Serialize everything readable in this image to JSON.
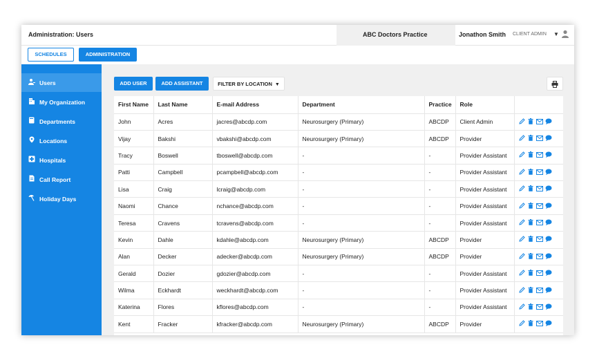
{
  "header": {
    "page_title": "Administration: Users",
    "practice_name": "ABC Doctors Practice",
    "user_name": "Jonathon Smith",
    "user_role": "CLIENT ADMIN"
  },
  "tabs": [
    {
      "label": "SCHEDULES",
      "active": false
    },
    {
      "label": "ADMINISTRATION",
      "active": true
    }
  ],
  "sidebar": {
    "items": [
      {
        "label": "Users",
        "icon": "users-icon",
        "active": true
      },
      {
        "label": "My Organization",
        "icon": "building-icon",
        "active": false
      },
      {
        "label": "Departments",
        "icon": "book-icon",
        "active": false
      },
      {
        "label": "Locations",
        "icon": "map-pin-icon",
        "active": false
      },
      {
        "label": "Hospitals",
        "icon": "hospital-cross-icon",
        "active": false
      },
      {
        "label": "Call Report",
        "icon": "document-icon",
        "active": false
      },
      {
        "label": "Holiday Days",
        "icon": "beach-umbrella-icon",
        "active": false
      }
    ]
  },
  "toolbar": {
    "add_user_label": "ADD USER",
    "add_assistant_label": "ADD ASSISTANT",
    "filter_label": "FILTER BY LOCATION",
    "print_icon": "printer-icon"
  },
  "table": {
    "columns": [
      "First Name",
      "Last Name",
      "E-mail Address",
      "Department",
      "Practice",
      "Role",
      ""
    ],
    "rows": [
      {
        "first": "John",
        "last": "Acres",
        "email": "jacres@abcdp.com",
        "department": "Neurosurgery (Primary)",
        "practice": "ABCDP",
        "role": "Client Admin"
      },
      {
        "first": "Vijay",
        "last": "Bakshi",
        "email": "vbakshi@abcdp.com",
        "department": "Neurosurgery (Primary)",
        "practice": "ABCDP",
        "role": "Provider"
      },
      {
        "first": "Tracy",
        "last": "Boswell",
        "email": "tboswell@abcdp.com",
        "department": "-",
        "practice": "-",
        "role": "Provider Assistant"
      },
      {
        "first": "Patti",
        "last": "Campbell",
        "email": "pcampbell@abcdp.com",
        "department": "-",
        "practice": "-",
        "role": "Provider Assistant"
      },
      {
        "first": "Lisa",
        "last": "Craig",
        "email": "lcraig@abcdp.com",
        "department": "-",
        "practice": "-",
        "role": "Provider Assistant"
      },
      {
        "first": "Naomi",
        "last": "Chance",
        "email": "nchance@abcdp.com",
        "department": "-",
        "practice": "-",
        "role": "Provider Assistant"
      },
      {
        "first": "Teresa",
        "last": "Cravens",
        "email": "tcravens@abcdp.com",
        "department": "-",
        "practice": "-",
        "role": "Provider Assistant"
      },
      {
        "first": "Kevin",
        "last": "Dahle",
        "email": "kdahle@abcdp.com",
        "department": "Neurosurgery (Primary)",
        "practice": "ABCDP",
        "role": "Provider"
      },
      {
        "first": "Alan",
        "last": "Decker",
        "email": "adecker@abcdp.com",
        "department": "Neurosurgery (Primary)",
        "practice": "ABCDP",
        "role": "Provider"
      },
      {
        "first": "Gerald",
        "last": "Dozier",
        "email": "gdozier@abcdp.com",
        "department": "-",
        "practice": "-",
        "role": "Provider Assistant"
      },
      {
        "first": "Wilma",
        "last": "Eckhardt",
        "email": "weckhardt@abcdp.com",
        "department": "-",
        "practice": "-",
        "role": "Provider Assistant"
      },
      {
        "first": "Katerina",
        "last": "Flores",
        "email": "kflores@abcdp.com",
        "department": "-",
        "practice": "-",
        "role": "Provider Assistant"
      },
      {
        "first": "Kent",
        "last": "Fracker",
        "email": "kfracker@abcdp.com",
        "department": "Neurosurgery (Primary)",
        "practice": "ABCDP",
        "role": "Provider"
      }
    ],
    "row_actions": [
      "edit-icon",
      "trash-icon",
      "email-icon",
      "chat-icon"
    ]
  },
  "colors": {
    "accent": "#1585e3",
    "sidebar_active": "#3a9ae9",
    "content_bg": "#f0f0f0"
  }
}
